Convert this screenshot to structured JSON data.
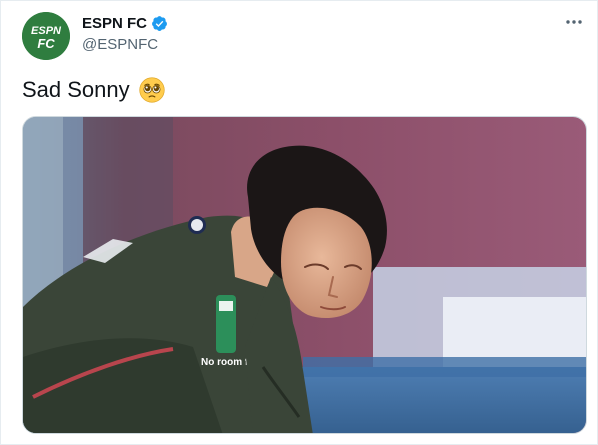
{
  "tweet": {
    "author": {
      "display_name": "ESPN FC",
      "handle": "@ESPNFC",
      "verified": true,
      "avatar_icon": "espn-fc-logo",
      "avatar_text_top": "ESPN",
      "avatar_text_bottom": "FC"
    },
    "text": "Sad Sonny",
    "emoji": "pleading-face-emoji",
    "media": {
      "kind": "photo",
      "description": "Footballer crouching on the pitch",
      "sponsor_text": "No room for racism"
    }
  },
  "colors": {
    "brand_green": "#2f7d3f",
    "verified_blue": "#1d9bf0",
    "text_primary": "#0f1419",
    "text_secondary": "#536471",
    "border": "#e6ecf0"
  }
}
